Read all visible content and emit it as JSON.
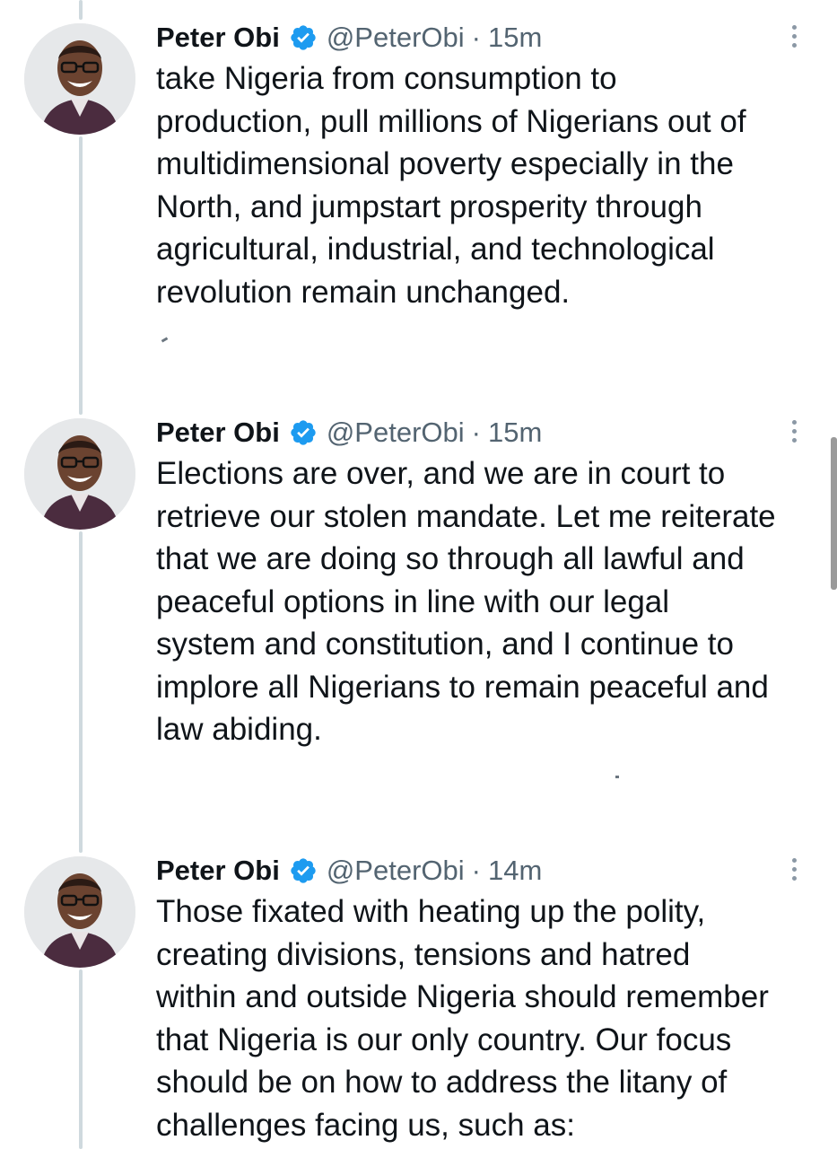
{
  "tweets": [
    {
      "author": "Peter Obi",
      "handle": "@PeterObi",
      "separator": "·",
      "time": "15m",
      "text": "take Nigeria from consumption to\nproduction, pull millions of Nigerians out of\nmultidimensional poverty especially in the\nNorth, and jumpstart prosperity through\nagricultural, industrial, and technological\nrevolution remain unchanged."
    },
    {
      "author": "Peter Obi",
      "handle": "@PeterObi",
      "separator": "·",
      "time": "15m",
      "text": "Elections are over, and we are in court to\nretrieve our stolen mandate. Let me reiterate\nthat we are doing so through all lawful and\npeaceful options in line with our legal\nsystem and constitution, and I continue to\nimplore all Nigerians to remain peaceful and\nlaw abiding."
    },
    {
      "author": "Peter Obi",
      "handle": "@PeterObi",
      "separator": "·",
      "time": "14m",
      "text": "Those fixated with heating up the polity,\ncreating divisions, tensions and hatred\nwithin and outside Nigeria should remember\nthat Nigeria is our only country. Our focus\nshould be on how to address the litany of\nchallenges facing us, such as:"
    }
  ],
  "icons": {
    "verified": "verified-badge-icon",
    "more": "more-options-icon"
  },
  "colors": {
    "verified_blue": "#1d9bf0",
    "text_primary": "#0f1419",
    "text_secondary": "#536471",
    "thread_line": "#cfd9de",
    "avatar_shirt": "#4b2c3f"
  }
}
